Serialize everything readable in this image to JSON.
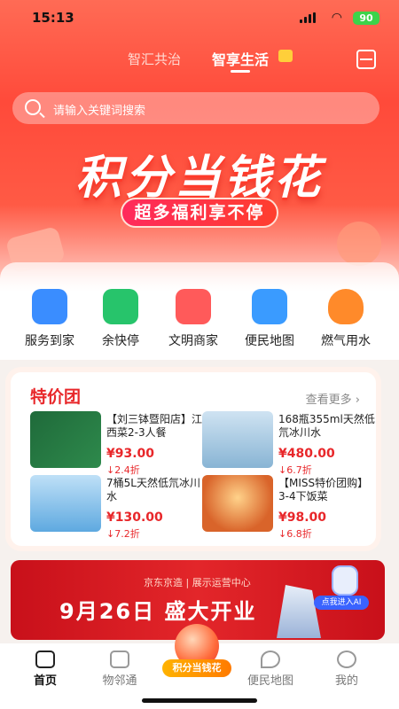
{
  "status": {
    "time": "15:13",
    "battery": "90"
  },
  "tabs": {
    "tab1": "智汇共治",
    "tab2": "智享生活"
  },
  "search": {
    "placeholder": "请输入关键词搜索"
  },
  "hero": {
    "title": "积分当钱花",
    "pill": "超多福利享不停"
  },
  "categories": [
    {
      "label": "服务到家",
      "icon": "house-icon",
      "color": "#3a8dff"
    },
    {
      "label": "余快停",
      "icon": "car-icon",
      "color": "#27c46b"
    },
    {
      "label": "文明商家",
      "icon": "shop-icon",
      "color": "#ff5a5a"
    },
    {
      "label": "便民地图",
      "icon": "map-icon",
      "color": "#3a9bff"
    },
    {
      "label": "燃气用水",
      "icon": "flame-icon",
      "color": "#ff8a2a"
    }
  ],
  "deals": {
    "title": "特价团",
    "more": "查看更多",
    "items": [
      {
        "name": "【刘三钵暨阳店】江西菜2-3人餐",
        "price": "¥93.00",
        "discount": "↓2.4折"
      },
      {
        "name": "168瓶355ml天然低氘冰川水",
        "price": "¥480.00",
        "discount": "↓6.7折"
      },
      {
        "name": "7桶5L天然低氘冰川水",
        "price": "¥130.00",
        "discount": "↓7.2折"
      },
      {
        "name": "【MISS特价团购】3-4下饭菜",
        "price": "¥98.00",
        "discount": "↓6.8折"
      }
    ]
  },
  "banner": {
    "sub": "京东京造 | 展示运营中心",
    "headline": "9月26日 盛大开业",
    "ai": "点我进入AI"
  },
  "nav": {
    "items": [
      "首页",
      "物邻通",
      "便民地图",
      "我的"
    ],
    "center": "积分当钱花"
  }
}
